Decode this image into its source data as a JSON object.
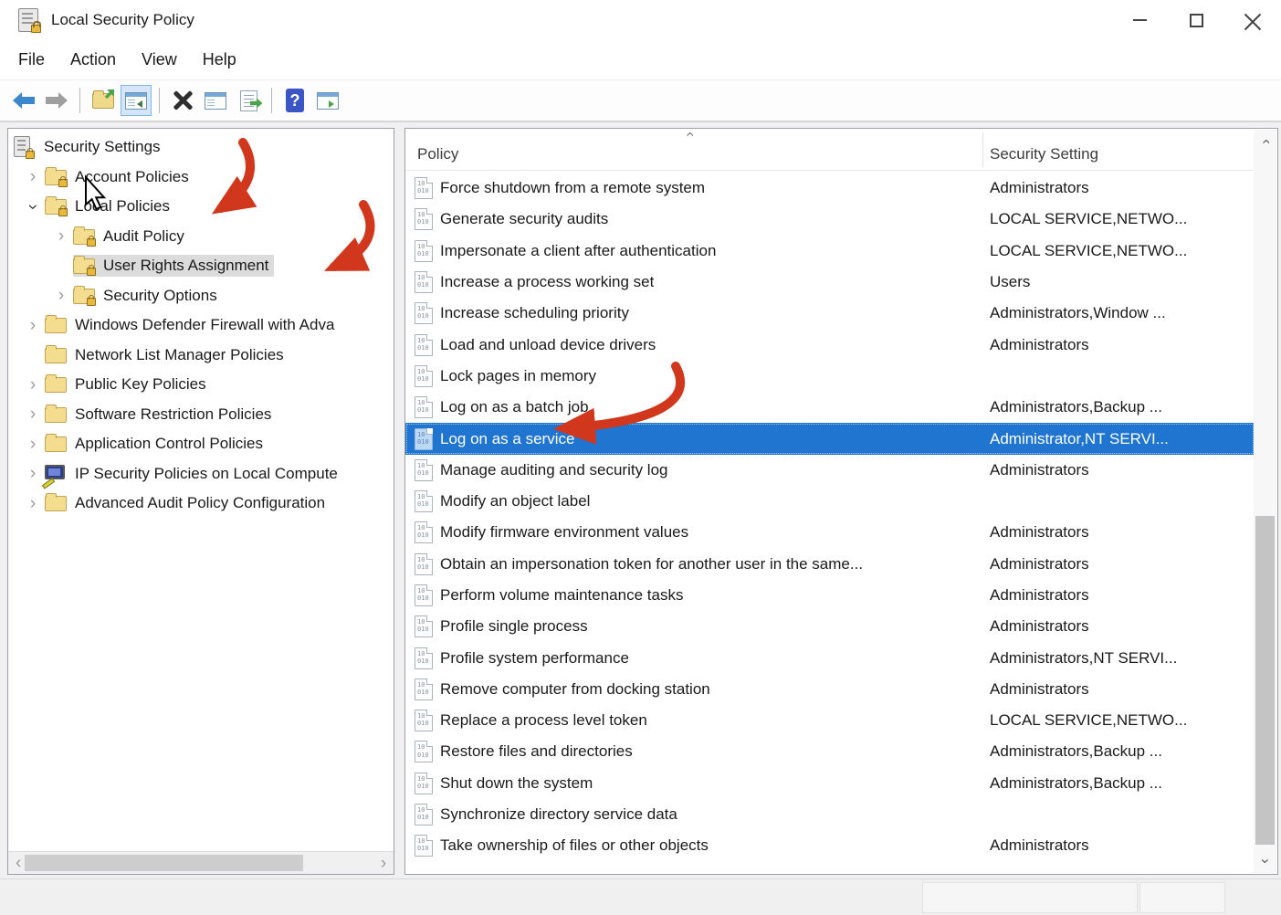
{
  "window": {
    "title": "Local Security Policy"
  },
  "menu": {
    "items": [
      "File",
      "Action",
      "View",
      "Help"
    ]
  },
  "toolbar": {
    "items": [
      "back",
      "forward",
      "|",
      "export-console",
      "show-console-tree",
      "|",
      "delete",
      "properties",
      "export-list",
      "|",
      "help",
      "new-window"
    ],
    "active_item": "show-console-tree",
    "help_glyph": "?"
  },
  "tree": {
    "items": [
      {
        "label": "Security Settings",
        "level": 0,
        "icon": "security-root",
        "expander": "none",
        "selected": false
      },
      {
        "label": "Account Policies",
        "level": 1,
        "icon": "folder-lock",
        "expander": "collapsed",
        "selected": false
      },
      {
        "label": "Local Policies",
        "level": 1,
        "icon": "folder-lock",
        "expander": "expanded",
        "selected": false
      },
      {
        "label": "Audit Policy",
        "level": 2,
        "icon": "folder-lock",
        "expander": "collapsed",
        "selected": false
      },
      {
        "label": "User Rights Assignment",
        "level": 2,
        "icon": "folder-lock",
        "expander": "none",
        "selected": true
      },
      {
        "label": "Security Options",
        "level": 2,
        "icon": "folder-lock",
        "expander": "collapsed",
        "selected": false
      },
      {
        "label": "Windows Defender Firewall with Adva",
        "level": 1,
        "icon": "folder",
        "expander": "collapsed",
        "selected": false
      },
      {
        "label": "Network List Manager Policies",
        "level": 1,
        "icon": "folder",
        "expander": "none",
        "selected": false
      },
      {
        "label": "Public Key Policies",
        "level": 1,
        "icon": "folder",
        "expander": "collapsed",
        "selected": false
      },
      {
        "label": "Software Restriction Policies",
        "level": 1,
        "icon": "folder",
        "expander": "collapsed",
        "selected": false
      },
      {
        "label": "Application Control Policies",
        "level": 1,
        "icon": "folder",
        "expander": "collapsed",
        "selected": false
      },
      {
        "label": "IP Security Policies on Local Compute",
        "level": 1,
        "icon": "ipsec",
        "expander": "collapsed",
        "selected": false
      },
      {
        "label": "Advanced Audit Policy Configuration",
        "level": 1,
        "icon": "folder",
        "expander": "collapsed",
        "selected": false
      }
    ]
  },
  "list": {
    "columns": [
      "Policy",
      "Security Setting"
    ],
    "sort": {
      "column": "Policy",
      "direction": "ascending"
    },
    "doc_icon_lines": [
      "10",
      "010"
    ],
    "rows": [
      {
        "policy": "Force shutdown from a remote system",
        "setting": "Administrators",
        "selected": false
      },
      {
        "policy": "Generate security audits",
        "setting": "LOCAL SERVICE,NETWO...",
        "selected": false
      },
      {
        "policy": "Impersonate a client after authentication",
        "setting": "LOCAL SERVICE,NETWO...",
        "selected": false
      },
      {
        "policy": "Increase a process working set",
        "setting": "Users",
        "selected": false
      },
      {
        "policy": "Increase scheduling priority",
        "setting": "Administrators,Window ...",
        "selected": false
      },
      {
        "policy": "Load and unload device drivers",
        "setting": "Administrators",
        "selected": false
      },
      {
        "policy": "Lock pages in memory",
        "setting": "",
        "selected": false
      },
      {
        "policy": "Log on as a batch job",
        "setting": "Administrators,Backup ...",
        "selected": false
      },
      {
        "policy": "Log on as a service",
        "setting": "Administrator,NT SERVI...",
        "selected": true
      },
      {
        "policy": "Manage auditing and security log",
        "setting": "Administrators",
        "selected": false
      },
      {
        "policy": "Modify an object label",
        "setting": "",
        "selected": false
      },
      {
        "policy": "Modify firmware environment values",
        "setting": "Administrators",
        "selected": false
      },
      {
        "policy": "Obtain an impersonation token for another user in the same...",
        "setting": "Administrators",
        "selected": false
      },
      {
        "policy": "Perform volume maintenance tasks",
        "setting": "Administrators",
        "selected": false
      },
      {
        "policy": "Profile single process",
        "setting": "Administrators",
        "selected": false
      },
      {
        "policy": "Profile system performance",
        "setting": "Administrators,NT SERVI...",
        "selected": false
      },
      {
        "policy": "Remove computer from docking station",
        "setting": "Administrators",
        "selected": false
      },
      {
        "policy": "Replace a process level token",
        "setting": "LOCAL SERVICE,NETWO...",
        "selected": false
      },
      {
        "policy": "Restore files and directories",
        "setting": "Administrators,Backup ...",
        "selected": false
      },
      {
        "policy": "Shut down the system",
        "setting": "Administrators,Backup ...",
        "selected": false
      },
      {
        "policy": "Synchronize directory service data",
        "setting": "",
        "selected": false
      },
      {
        "policy": "Take ownership of files or other objects",
        "setting": "Administrators",
        "selected": false
      }
    ]
  },
  "annotations": {
    "arrows": [
      "local-policies",
      "user-rights-assignment",
      "log-on-as-a-service"
    ]
  },
  "colors": {
    "selection_blue": "#1f75cf",
    "tree_selection_gray": "#dcdcdc",
    "arrow_red": "#d0371c",
    "folder_yellow": "#f5dd8f"
  }
}
